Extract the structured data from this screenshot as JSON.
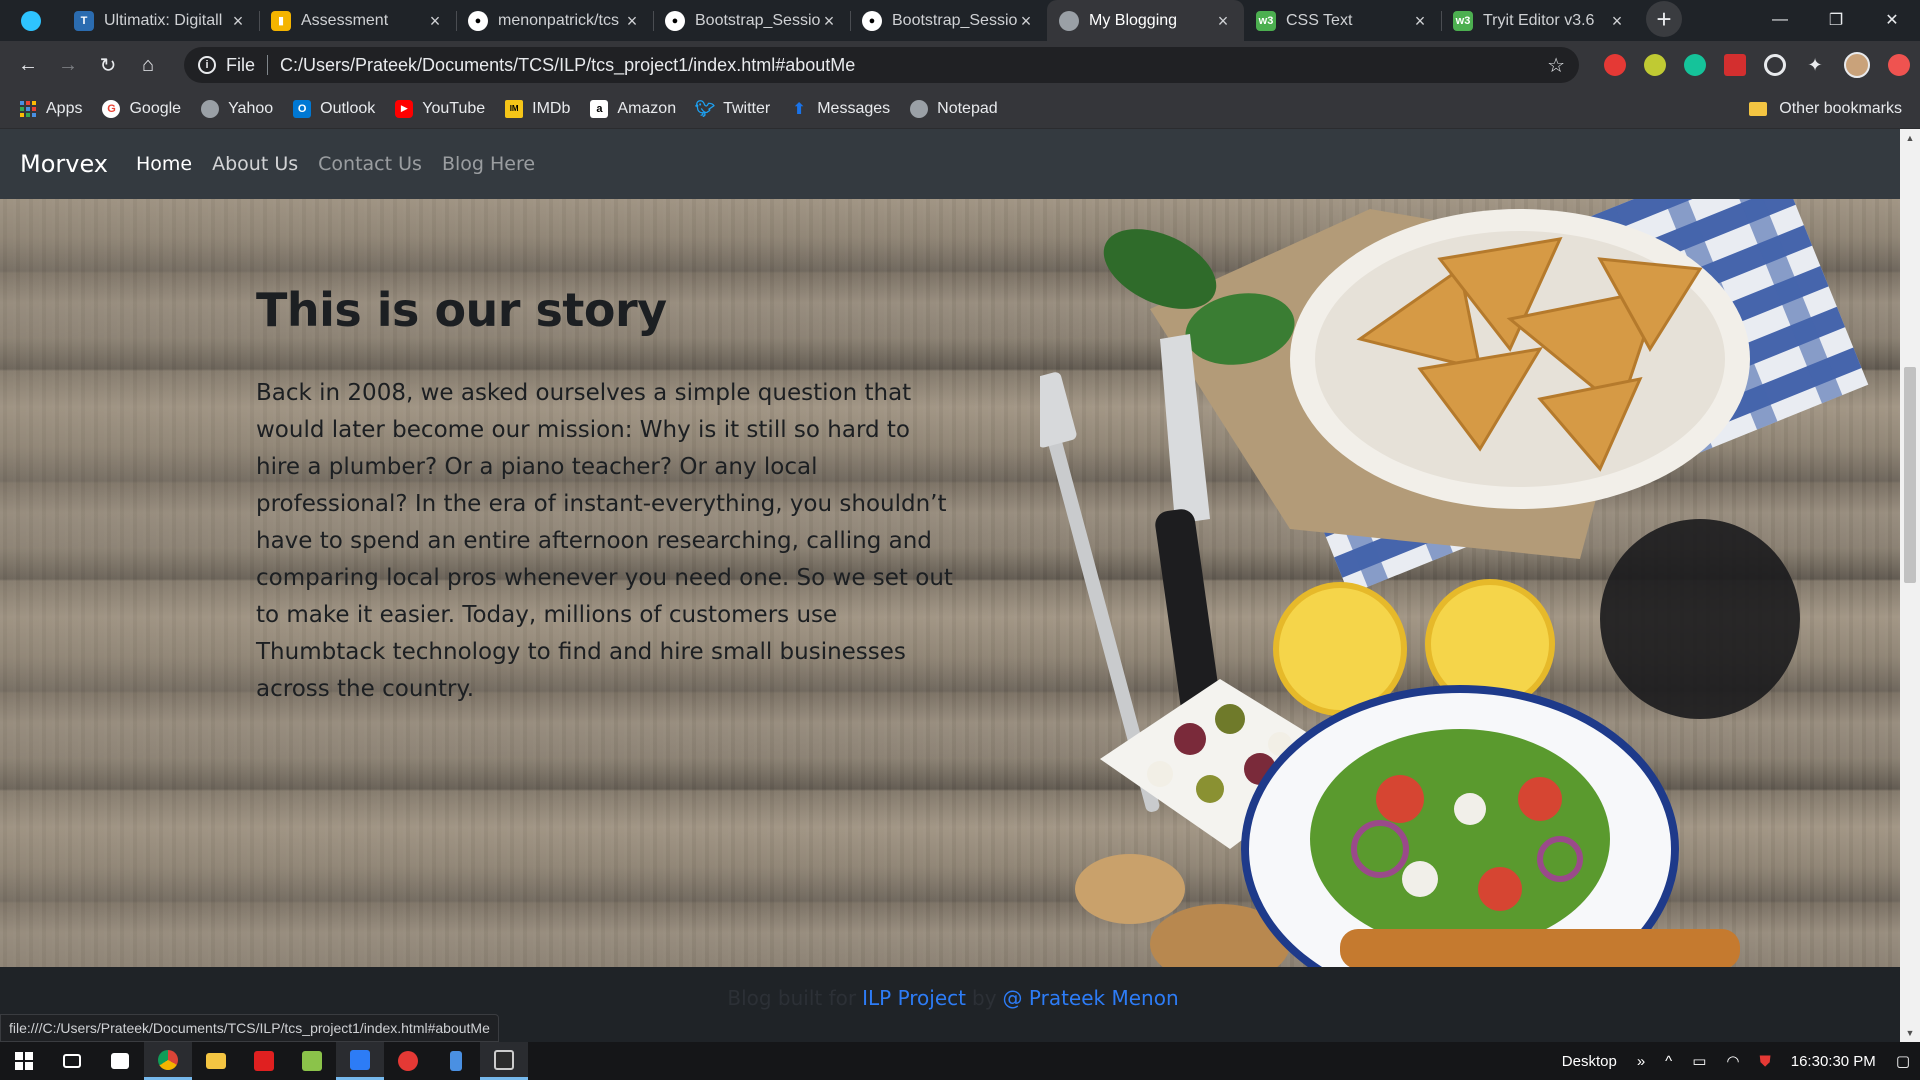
{
  "browser": {
    "tabs": [
      {
        "title": "Ultimatix: Digitall",
        "favicon": "tcs-icon",
        "color": "#2b6cb0"
      },
      {
        "title": "Assessment",
        "favicon": "chart-icon",
        "color": "#f4b400"
      },
      {
        "title": "menonpatrick/tcs",
        "favicon": "github-icon",
        "color": "#ffffff"
      },
      {
        "title": "Bootstrap_Sessio",
        "favicon": "github-icon",
        "color": "#ffffff"
      },
      {
        "title": "Bootstrap_Sessio",
        "favicon": "github-icon",
        "color": "#ffffff"
      },
      {
        "title": "My Blogging",
        "favicon": "globe-icon",
        "color": "#9aa0a6"
      },
      {
        "title": "CSS Text",
        "favicon": "w3-icon",
        "color": "#4caf50"
      },
      {
        "title": "Tryit Editor v3.6",
        "favicon": "w3-icon",
        "color": "#4caf50"
      }
    ],
    "active_tab_index": 5,
    "address": {
      "scheme_label": "File",
      "url": "C:/Users/Prateek/Documents/TCS/ILP/tcs_project1/index.html#aboutMe"
    },
    "bookmarks": [
      {
        "label": "Apps",
        "icon": "apps-grid-icon",
        "color": "#4a90e2"
      },
      {
        "label": "Google",
        "icon": "google-icon",
        "color": "#ea4335"
      },
      {
        "label": "Yahoo",
        "icon": "globe-icon",
        "color": "#9aa0a6"
      },
      {
        "label": "Outlook",
        "icon": "outlook-icon",
        "color": "#0078d4"
      },
      {
        "label": "YouTube",
        "icon": "youtube-icon",
        "color": "#ff0000"
      },
      {
        "label": "IMDb",
        "icon": "imdb-icon",
        "color": "#f5c518"
      },
      {
        "label": "Amazon",
        "icon": "amazon-icon",
        "color": "#ffffff"
      },
      {
        "label": "Twitter",
        "icon": "twitter-icon",
        "color": "#1da1f2"
      },
      {
        "label": "Messages",
        "icon": "messages-icon",
        "color": "#1a73e8"
      },
      {
        "label": "Notepad",
        "icon": "globe-icon",
        "color": "#9aa0a6"
      }
    ],
    "other_bookmarks": "Other bookmarks",
    "status_url": "file:///C:/Users/Prateek/Documents/TCS/ILP/tcs_project1/index.html#aboutMe"
  },
  "site": {
    "brand": "Morvex",
    "nav": [
      {
        "label": "Home"
      },
      {
        "label": "About Us"
      },
      {
        "label": "Contact Us"
      },
      {
        "label": "Blog Here"
      }
    ],
    "story": {
      "title": "This is our story",
      "body": "Back in 2008, we asked ourselves a simple question that would later become our mission: Why is it still so hard to hire a plumber? Or a piano teacher? Or any local professional? In the era of instant-everything, you shouldn’t have to spend an entire afternoon researching, calling and comparing local pros whenever you need one. So we set out to make it easier. Today, millions of customers use Thumbtack technology to find and hire small businesses across the country."
    },
    "footer": {
      "prefix": "Blog built for",
      "project_link": "ILP Project",
      "middle": "by",
      "author_link": "@ Prateek Menon"
    }
  },
  "taskbar": {
    "desktop_label": "Desktop",
    "clock": "16:30:30 PM",
    "apps": [
      {
        "name": "start-icon",
        "color": "#ffffff"
      },
      {
        "name": "task-view-icon",
        "color": "#ffffff"
      },
      {
        "name": "store-icon",
        "color": "#ffffff"
      },
      {
        "name": "chrome-icon",
        "color": "#db4437"
      },
      {
        "name": "file-explorer-icon",
        "color": "#f4c542"
      },
      {
        "name": "acrobat-icon",
        "color": "#e02020"
      },
      {
        "name": "notepad-plus-icon",
        "color": "#8bc34a"
      },
      {
        "name": "vscode-icon",
        "color": "#2d7cf6"
      },
      {
        "name": "app-red-icon",
        "color": "#e53935"
      },
      {
        "name": "app-figure-icon",
        "color": "#4a90e2"
      },
      {
        "name": "terminal-icon",
        "color": "#cccccc"
      }
    ]
  }
}
